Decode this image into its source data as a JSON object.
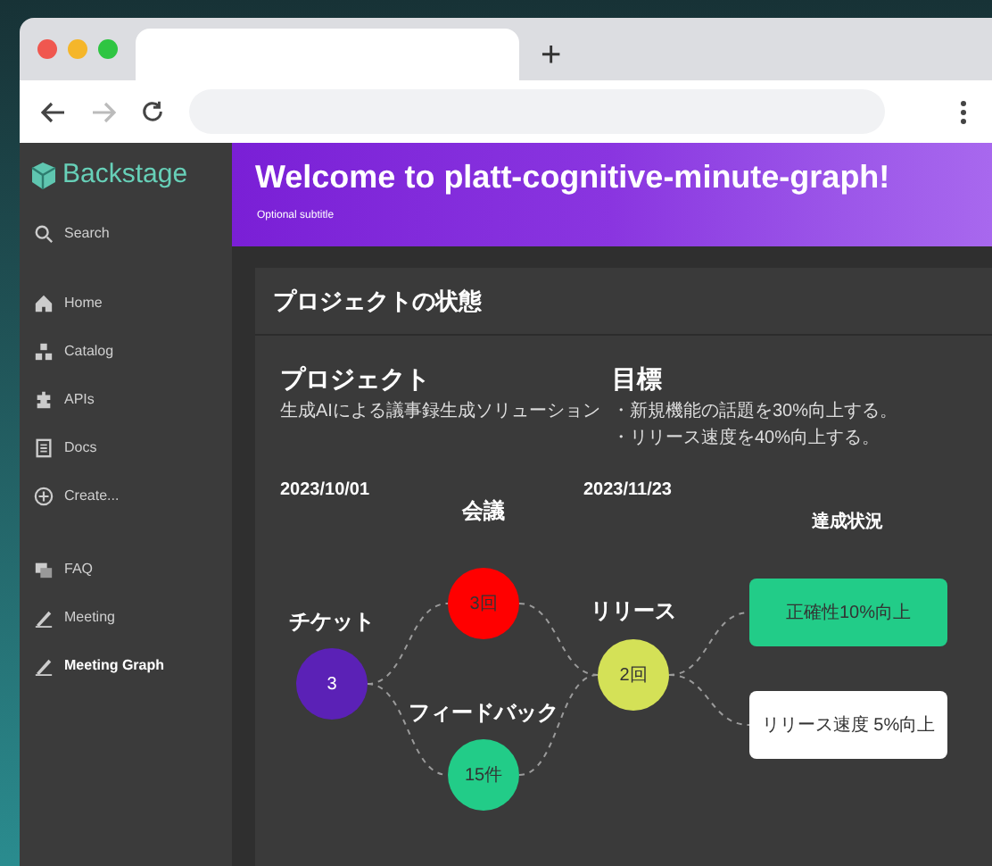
{
  "browser": {
    "new_tab": "+"
  },
  "sidebar": {
    "logo": "Backstage",
    "items": [
      {
        "kind": "search",
        "label": "Search",
        "selected": false
      },
      {
        "kind": "home",
        "label": "Home",
        "selected": false
      },
      {
        "kind": "catalog",
        "label": "Catalog",
        "selected": false
      },
      {
        "kind": "apis",
        "label": "APIs",
        "selected": false
      },
      {
        "kind": "docs",
        "label": "Docs",
        "selected": false
      },
      {
        "kind": "create",
        "label": "Create...",
        "selected": false
      },
      {
        "kind": "faq",
        "label": "FAQ",
        "selected": false
      },
      {
        "kind": "pen",
        "label": "Meeting",
        "selected": false
      },
      {
        "kind": "pen",
        "label": "Meeting Graph",
        "selected": true
      }
    ]
  },
  "header": {
    "title": "Welcome to platt-cognitive-minute-graph!",
    "subtitle": "Optional subtitle"
  },
  "card": {
    "title": "プロジェクトの状態",
    "project": {
      "heading": "プロジェクト",
      "description": "生成AIによる議事録生成ソリューション"
    },
    "goals": {
      "heading": "目標",
      "items": [
        "・新規機能の話題を30%向上する。",
        "・リリース速度を40%向上する。"
      ]
    },
    "graph": {
      "dates": [
        "2023/10/01",
        "2023/11/23"
      ],
      "status_heading": "達成状況",
      "nodes": [
        {
          "kind": "circle",
          "label": "チケット",
          "value": "3",
          "color": "#5b21b6"
        },
        {
          "kind": "circle",
          "label": "会議",
          "value": "3回",
          "color": "#ff0000"
        },
        {
          "kind": "circle",
          "label": "フィードバック",
          "value": "15件",
          "color": "#22cc88"
        },
        {
          "kind": "circle",
          "label": "リリース",
          "value": "2回",
          "color": "#d4e157"
        },
        {
          "kind": "box",
          "value": "正確性10%向上",
          "color": "#22cc88"
        },
        {
          "kind": "box",
          "value": "リリース速度 5%向上",
          "color": "#ffffff"
        }
      ]
    }
  }
}
